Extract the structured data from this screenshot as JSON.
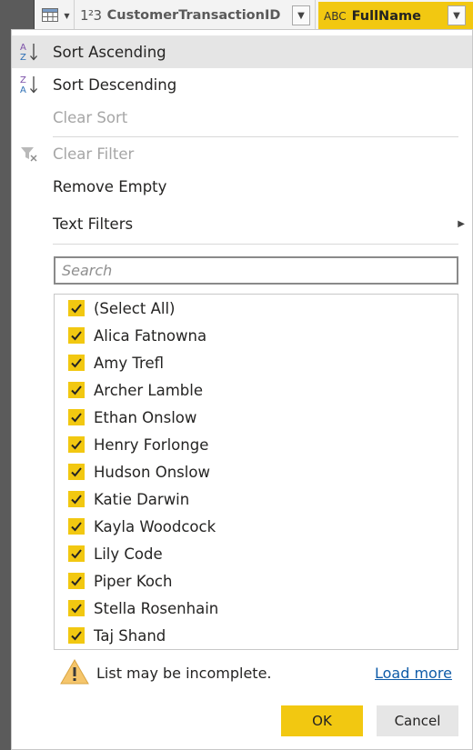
{
  "header": {
    "cust_type_icon": "1²3",
    "cust_label": "CustomerTransactionID",
    "full_type_icon": "ABC",
    "full_label": "FullName",
    "dropdown_glyph": "▼"
  },
  "menu": {
    "sort_asc": "Sort Ascending",
    "sort_desc": "Sort Descending",
    "clear_sort": "Clear Sort",
    "clear_filter": "Clear Filter",
    "remove_empty": "Remove Empty",
    "text_filters": "Text Filters",
    "submenu_arrow": "▶"
  },
  "search": {
    "placeholder": "Search"
  },
  "list": {
    "items": [
      {
        "label": "(Select All)",
        "checked": true
      },
      {
        "label": "Alica Fatnowna",
        "checked": true
      },
      {
        "label": "Amy Trefl",
        "checked": true
      },
      {
        "label": "Archer Lamble",
        "checked": true
      },
      {
        "label": "Ethan Onslow",
        "checked": true
      },
      {
        "label": "Henry Forlonge",
        "checked": true
      },
      {
        "label": "Hudson Onslow",
        "checked": true
      },
      {
        "label": "Katie Darwin",
        "checked": true
      },
      {
        "label": "Kayla Woodcock",
        "checked": true
      },
      {
        "label": "Lily Code",
        "checked": true
      },
      {
        "label": "Piper Koch",
        "checked": true
      },
      {
        "label": "Stella Rosenhain",
        "checked": true
      },
      {
        "label": "Taj Shand",
        "checked": true
      }
    ]
  },
  "footer": {
    "warning_text": "List may be incomplete.",
    "load_more": "Load more",
    "ok": "OK",
    "cancel": "Cancel"
  },
  "colors": {
    "accent": "#f2c811",
    "link": "#0e5ba8",
    "disabled": "#a6a6a6"
  }
}
